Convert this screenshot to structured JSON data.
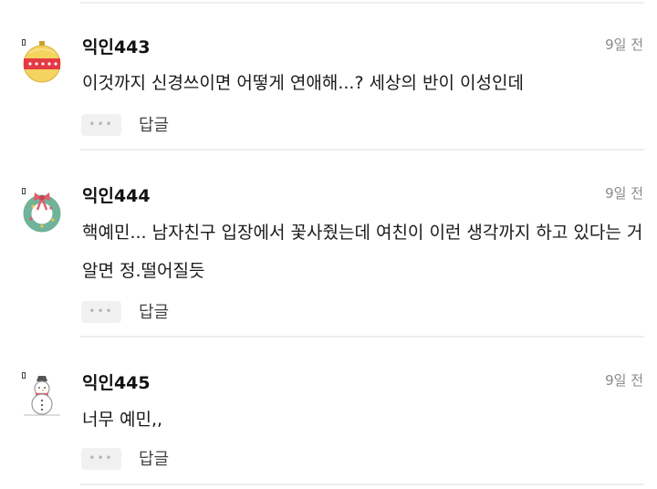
{
  "comments": [
    {
      "author": "익인443",
      "time": "9일 전",
      "text": "이것까지 신경쓰이면 어떻게 연애해...? 세상의 반이 이성인데",
      "more_label": "•••",
      "reply_label": "답글",
      "avatar_icon": "ornament-ball-icon",
      "avatar_colors": {
        "base": "#f4d35e",
        "band": "#e63946",
        "dots": "#ffffff"
      }
    },
    {
      "author": "익인444",
      "time": "9일 전",
      "text": "핵예민... 남자친구 입장에서 꽃사줬는데 여친이 이런 생각까지 하고 있다는 거 알면 정.떨어질듯",
      "more_label": "•••",
      "reply_label": "답글",
      "avatar_icon": "christmas-wreath-icon",
      "avatar_colors": {
        "wreath": "#6fb39a",
        "bow": "#e35d6a",
        "dots": "#f4c542"
      }
    },
    {
      "author": "익인445",
      "time": "9일 전",
      "text": "너무 예민,,",
      "more_label": "•••",
      "reply_label": "답글",
      "avatar_icon": "snowman-icon",
      "avatar_colors": {
        "body": "#ffffff",
        "outline": "#999999",
        "scarf": "#e35d6a"
      }
    }
  ]
}
